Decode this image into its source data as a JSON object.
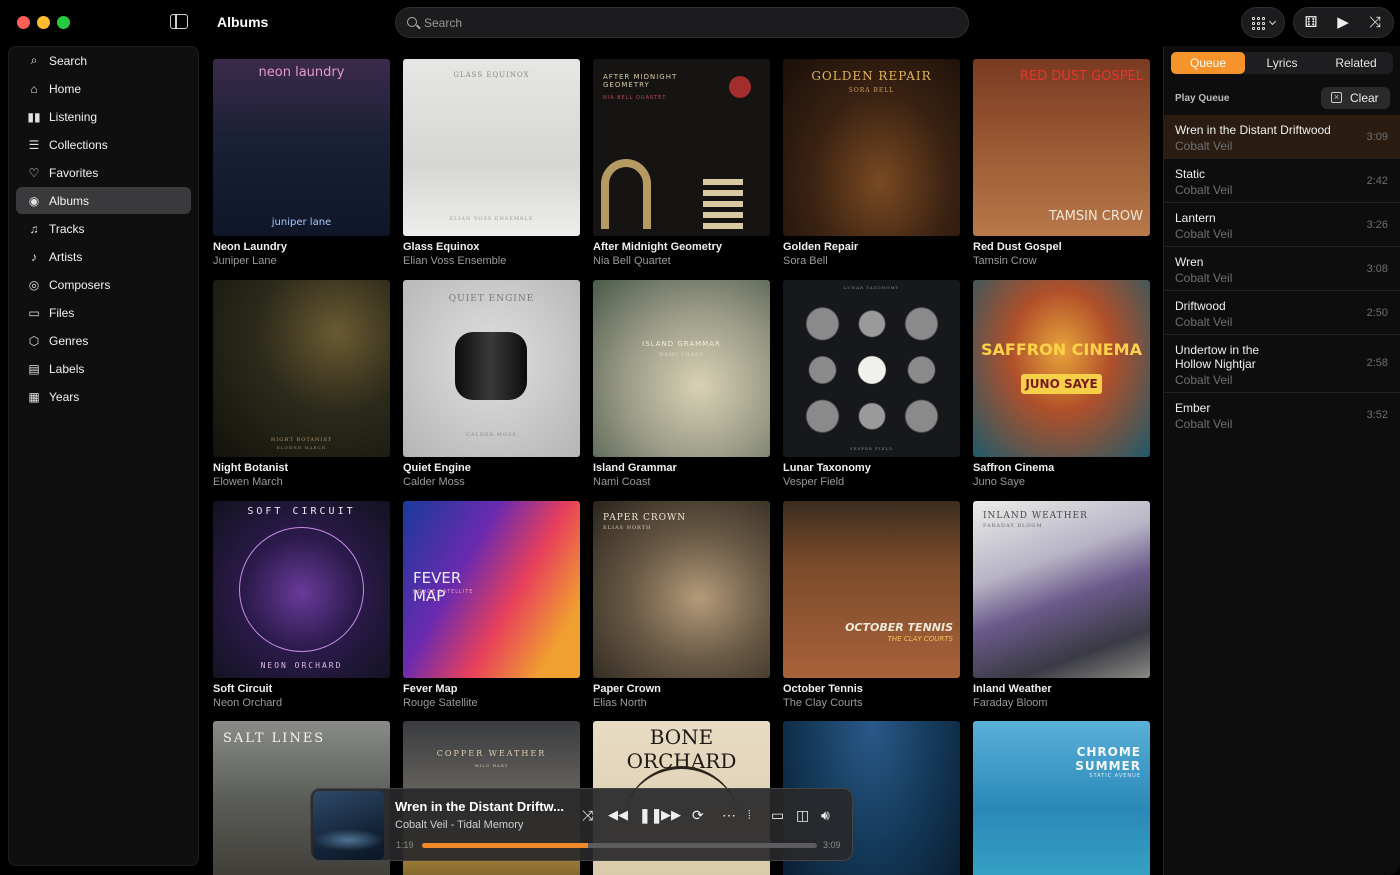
{
  "window": {
    "title": "Albums"
  },
  "search": {
    "placeholder": "Search"
  },
  "sidebar": {
    "items": [
      {
        "label": "Search",
        "icon": "search-icon"
      },
      {
        "label": "Home",
        "icon": "home-icon"
      },
      {
        "label": "Listening",
        "icon": "bar-chart-icon"
      },
      {
        "label": "Collections",
        "icon": "collections-icon"
      },
      {
        "label": "Favorites",
        "icon": "heart-icon"
      },
      {
        "label": "Albums",
        "icon": "album-icon",
        "active": true
      },
      {
        "label": "Tracks",
        "icon": "music-note-icon"
      },
      {
        "label": "Artists",
        "icon": "microphone-icon"
      },
      {
        "label": "Composers",
        "icon": "composer-icon"
      },
      {
        "label": "Files",
        "icon": "folder-icon"
      },
      {
        "label": "Genres",
        "icon": "cube-icon"
      },
      {
        "label": "Labels",
        "icon": "label-icon"
      },
      {
        "label": "Years",
        "icon": "calendar-icon"
      }
    ]
  },
  "albums": [
    {
      "title": "Neon Laundry",
      "artist": "Juniper Lane",
      "cover_text": "neon laundry",
      "cover_subtext": "juniper lane"
    },
    {
      "title": "Glass Equinox",
      "artist": "Elian Voss Ensemble",
      "cover_text": "GLASS EQUINOX",
      "cover_subtext": "ELIAN VOSS ENSEMBLE"
    },
    {
      "title": "After Midnight Geometry",
      "artist": "Nia Bell Quartet",
      "cover_text": "AFTER MIDNIGHT GEOMETRY",
      "cover_subtext": "NIA BELL QUARTET"
    },
    {
      "title": "Golden Repair",
      "artist": "Sora Bell",
      "cover_text": "GOLDEN REPAIR",
      "cover_subtext": "SORA BELL"
    },
    {
      "title": "Red Dust Gospel",
      "artist": "Tamsin Crow",
      "cover_text": "RED DUST GOSPEL",
      "cover_subtext": "TAMSIN CROW"
    },
    {
      "title": "Night Botanist",
      "artist": "Elowen March",
      "cover_text": "NIGHT BOTANIST",
      "cover_subtext": "ELOWEN MARCH"
    },
    {
      "title": "Quiet Engine",
      "artist": "Calder Moss",
      "cover_text": "QUIET ENGINE",
      "cover_subtext": "CALDER MOSS"
    },
    {
      "title": "Island Grammar",
      "artist": "Nami Coast",
      "cover_text": "ISLAND GRAMMAR",
      "cover_subtext": "NAMI COAST"
    },
    {
      "title": "Lunar Taxonomy",
      "artist": "Vesper Field",
      "cover_text": "LUNAR TAXONOMY",
      "cover_subtext": "VESPER FIELD"
    },
    {
      "title": "Saffron Cinema",
      "artist": "Juno Saye",
      "cover_text": "SAFFRON CINEMA",
      "cover_subtext": "JUNO SAYE"
    },
    {
      "title": "Soft Circuit",
      "artist": "Neon Orchard",
      "cover_text": "SOFT CIRCUIT",
      "cover_subtext": "NEON ORCHARD"
    },
    {
      "title": "Fever Map",
      "artist": "Rouge Satellite",
      "cover_text": "FEVER MAP",
      "cover_subtext": "ROUGE SATELLITE"
    },
    {
      "title": "Paper Crown",
      "artist": "Elias North",
      "cover_text": "PAPER CROWN",
      "cover_subtext": "ELIAS NORTH"
    },
    {
      "title": "October Tennis",
      "artist": "The Clay Courts",
      "cover_text": "OCTOBER TENNIS",
      "cover_subtext": "THE CLAY COURTS"
    },
    {
      "title": "Inland Weather",
      "artist": "Faraday Bloom",
      "cover_text": "INLAND WEATHER",
      "cover_subtext": "FARADAY BLOOM"
    },
    {
      "title": "",
      "artist": "",
      "cover_text": "SALT LINES",
      "cover_subtext": ""
    },
    {
      "title": "",
      "artist": "",
      "cover_text": "COPPER WEATHER",
      "cover_subtext": "MILO HART"
    },
    {
      "title": "",
      "artist": "",
      "cover_text": "BONE ORCHARD",
      "cover_subtext": ""
    },
    {
      "title": "",
      "artist": "",
      "cover_text": "",
      "cover_subtext": ""
    },
    {
      "title": "",
      "artist": "",
      "cover_text": "CHROME SUMMER",
      "cover_subtext": "STATIC AVENUE"
    }
  ],
  "right_panel": {
    "tabs": [
      {
        "label": "Queue",
        "active": true
      },
      {
        "label": "Lyrics"
      },
      {
        "label": "Related"
      }
    ],
    "play_queue_label": "Play Queue",
    "clear_label": "Clear",
    "queue": [
      {
        "title": "Wren in the Distant Driftwood",
        "artist": "Cobalt Veil",
        "duration": "3:09",
        "current": true
      },
      {
        "title": "Static",
        "artist": "Cobalt Veil",
        "duration": "2:42"
      },
      {
        "title": "Lantern",
        "artist": "Cobalt Veil",
        "duration": "3:26"
      },
      {
        "title": "Wren",
        "artist": "Cobalt Veil",
        "duration": "3:08"
      },
      {
        "title": "Driftwood",
        "artist": "Cobalt Veil",
        "duration": "2:50"
      },
      {
        "title": "Undertow in the Hollow Nightjar",
        "artist": "Cobalt Veil",
        "duration": "2:58"
      },
      {
        "title": "Ember",
        "artist": "Cobalt Veil",
        "duration": "3:52"
      }
    ]
  },
  "player": {
    "title": "Wren in the Distant Driftw...",
    "subtitle": "Cobalt Veil - Tidal Memory",
    "elapsed": "1:19",
    "total": "3:09",
    "progress_fraction": 0.42
  },
  "colors": {
    "accent": "#f7932b",
    "progress": "#f28a2a",
    "active_nav": "#3a3a3c"
  }
}
